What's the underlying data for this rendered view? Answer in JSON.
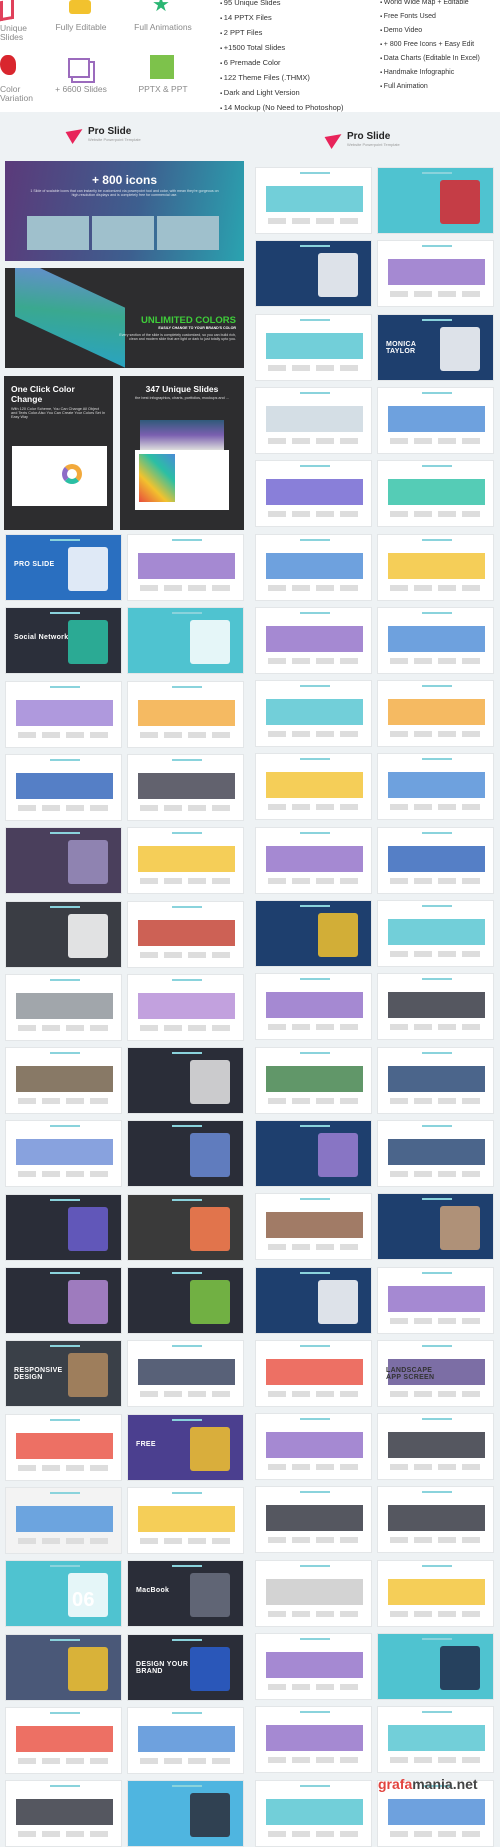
{
  "features": [
    {
      "label": "Unique Slides",
      "icon": "layers-icon",
      "color": "#e0405a"
    },
    {
      "label": "Fully Editable",
      "icon": "pencil-star-icon",
      "color": "#f2c22e"
    },
    {
      "label": "Full Animations",
      "icon": "star-icon",
      "color": "#2bb673"
    },
    {
      "label": "Color Variation",
      "icon": "palette-icon",
      "color": "#d9262e"
    },
    {
      "label": "+ 6600 Slides",
      "icon": "stacked-slides-icon",
      "color": "#9b6bbd"
    },
    {
      "label": "PPTX & PPT",
      "icon": "file-icon",
      "color": "#7dc24b"
    }
  ],
  "bullets_left": [
    "95 Unique Slides",
    "14 PPTX Files",
    "2 PPT Files",
    "+1500 Total Slides",
    "6 Premade Color",
    "122 Theme Files (.THMX)",
    "Dark and Light Version",
    "14 Mockup (No Need to Photoshop)"
  ],
  "bullets_right": [
    "World Wide Map + Editable",
    "Free Fonts Used",
    "Demo Video",
    "+ 800 Free Icons + Easy Edit",
    "Data Charts (Editable In Excel)",
    "Handmake Infographic",
    "Full Animation"
  ],
  "logo": {
    "title": "Pro Slide",
    "subtitle": "Website Powerpoint Template",
    "color": "#e8245a"
  },
  "promo": {
    "icons_title": "+ 800 icons",
    "icons_text": "1 Slide of scalable icons that can instantly be customized via powerpoint tool and color, with mean they're gorgeous on high-resolution displays and is completely free for commercial use.",
    "colors_title": "UNLIMITED COLORS",
    "colors_sub": "EASILY CHANGE TO YOUR BRAND'S COLOR",
    "colors_text": "Every section of the slide is completely customized, so you can build rich, clean and modern slide that are light or dark to just totally upto you.",
    "oneclick_title": "One Click Color Change",
    "oneclick_text": "With 120 Color Scheme, You Can Change All Object and Texts Color.Also You Can Create Your Colors Set In Easy Way",
    "unique_title": "347 Unique Slides",
    "unique_text": "the best infographics, charts, portfolios, mockups and ..."
  },
  "left_slides": [
    [
      [
        "#2a6fc0",
        "#ffffff",
        "PRO SLIDE"
      ],
      [
        "#ffffff",
        "#8e6bc7",
        ""
      ]
    ],
    [
      [
        "#2b2f3a",
        "#2bbfa4",
        "Social Network"
      ],
      [
        "#4fc3d0",
        "#ffffff",
        ""
      ]
    ],
    [
      [
        "#ffffff",
        "#9b7fd4",
        ""
      ],
      [
        "#ffffff",
        "#f2a93b",
        ""
      ]
    ],
    [
      [
        "#ffffff",
        "#2a5fb8",
        ""
      ],
      [
        "#ffffff",
        "#3b3b4a",
        ""
      ]
    ],
    [
      [
        "#4a3f5c",
        "#9b8fbf",
        ""
      ],
      [
        "#ffffff",
        "#f2c22e",
        ""
      ]
    ],
    [
      [
        "#3a3d44",
        "#ffffff",
        ""
      ],
      [
        "#ffffff",
        "#c0392b",
        ""
      ]
    ],
    [
      [
        "#ffffff",
        "#8a9096",
        ""
      ],
      [
        "#ffffff",
        "#b38ad6",
        ""
      ]
    ],
    [
      [
        "#ffffff",
        "#6a5840",
        ""
      ],
      [
        "#2a2d38",
        "#e8e8e8",
        ""
      ]
    ],
    [
      [
        "#ffffff",
        "#6a8bd6",
        ""
      ],
      [
        "#2a2d38",
        "#6a8bd6",
        ""
      ]
    ],
    [
      [
        "#2a2d38",
        "#6b5fd0",
        ""
      ],
      [
        "#3a3a3a",
        "#ff7f50",
        ""
      ]
    ],
    [
      [
        "#2a2d38",
        "#b38ad6",
        ""
      ],
      [
        "#2a2d38",
        "#7ec845",
        ""
      ]
    ],
    [
      [
        "#3a4048",
        "#b08a60",
        "RESPONSIVE DESIGN"
      ],
      [
        "#ffffff",
        "#2e3a56",
        ""
      ]
    ],
    [
      [
        "#ffffff",
        "#e84c3d",
        ""
      ],
      [
        "#4b3f8f",
        "#f2c22e",
        "FREE"
      ]
    ],
    [
      [
        "#f3f3f3",
        "#4a90d9",
        ""
      ],
      [
        "#ffffff",
        "#f2c22e",
        ""
      ]
    ],
    [
      [
        "#4fc3d0",
        "#ffffff",
        "06"
      ],
      [
        "#2a2d38",
        "#6a7080",
        "MacBook"
      ]
    ],
    [
      [
        "#4a5878",
        "#f2c22e",
        ""
      ],
      [
        "#2a2d38",
        "#2a5fd0",
        "DESIGN YOUR BRAND"
      ]
    ],
    [
      [
        "#ffffff",
        "#e84c3d",
        ""
      ],
      [
        "#ffffff",
        "#4a8ad6",
        ""
      ]
    ],
    [
      [
        "#ffffff",
        "#2a2d38",
        ""
      ],
      [
        "#4fb5e0",
        "#2a2d38",
        ""
      ]
    ]
  ],
  "right_slides": [
    [
      [
        "#ffffff",
        "#4fc3d0",
        ""
      ],
      [
        "#4fc3d0",
        "#d9262e",
        ""
      ]
    ],
    [
      [
        "#1e3f6e",
        "#ffffff",
        ""
      ],
      [
        "#ffffff",
        "#8e6bc7",
        ""
      ]
    ],
    [
      [
        "#ffffff",
        "#4fc3d0",
        ""
      ],
      [
        "#1e3f6e",
        "#ffffff",
        "MONICA TAYLOR"
      ]
    ],
    [
      [
        "#ffffff",
        "#c9d6df",
        ""
      ],
      [
        "#ffffff",
        "#4a8ad6",
        ""
      ]
    ],
    [
      [
        "#ffffff",
        "#6b5fd0",
        ""
      ],
      [
        "#ffffff",
        "#2bbfa4",
        ""
      ]
    ],
    [
      [
        "#ffffff",
        "#4a8ad6",
        ""
      ],
      [
        "#ffffff",
        "#f2c22e",
        ""
      ]
    ],
    [
      [
        "#ffffff",
        "#8e6bc7",
        ""
      ],
      [
        "#ffffff",
        "#4a8ad6",
        ""
      ]
    ],
    [
      [
        "#ffffff",
        "#4fc3d0",
        ""
      ],
      [
        "#ffffff",
        "#f2a93b",
        ""
      ]
    ],
    [
      [
        "#ffffff",
        "#f2c22e",
        ""
      ],
      [
        "#ffffff",
        "#4a8ad6",
        ""
      ]
    ],
    [
      [
        "#ffffff",
        "#8e6bc7",
        ""
      ],
      [
        "#ffffff",
        "#2a5fb8",
        ""
      ]
    ],
    [
      [
        "#1e3f6e",
        "#f2c22e",
        ""
      ],
      [
        "#ffffff",
        "#4fc3d0",
        ""
      ]
    ],
    [
      [
        "#ffffff",
        "#8e6bc7",
        ""
      ],
      [
        "#ffffff",
        "#2a2d38",
        ""
      ]
    ],
    [
      [
        "#ffffff",
        "#3a7d44",
        ""
      ],
      [
        "#ffffff",
        "#1e3f6e",
        ""
      ]
    ],
    [
      [
        "#1e3f6e",
        "#9b7fd4",
        ""
      ],
      [
        "#ffffff",
        "#1e3f6e",
        ""
      ]
    ],
    [
      [
        "#ffffff",
        "#8a5a40",
        ""
      ],
      [
        "#1e3f6e",
        "#c9a07a",
        ""
      ]
    ],
    [
      [
        "#1e3f6e",
        "#ffffff",
        ""
      ],
      [
        "#ffffff",
        "#8e6bc7",
        ""
      ]
    ],
    [
      [
        "#ffffff",
        "#e84c3d",
        ""
      ],
      [
        "#ffffff",
        "#5b4a8f",
        "LANDSCAPE APP SCREEN"
      ]
    ],
    [
      [
        "#ffffff",
        "#8e6bc7",
        ""
      ],
      [
        "#ffffff",
        "#2a2d38",
        ""
      ]
    ],
    [
      [
        "#ffffff",
        "#2a2d38",
        ""
      ],
      [
        "#ffffff",
        "#2a2d38",
        ""
      ]
    ],
    [
      [
        "#ffffff",
        "#c8c8c8",
        ""
      ],
      [
        "#ffffff",
        "#f2c22e",
        ""
      ]
    ],
    [
      [
        "#ffffff",
        "#8e6bc7",
        ""
      ],
      [
        "#4fc3d0",
        "#1e2a4a",
        ""
      ]
    ],
    [
      [
        "#ffffff",
        "#8e6bc7",
        ""
      ],
      [
        "#ffffff",
        "#4fc3d0",
        ""
      ]
    ],
    [
      [
        "#ffffff",
        "#4fc3d0",
        ""
      ],
      [
        "#ffffff",
        "#4a8ad6",
        ""
      ]
    ]
  ],
  "watermark": {
    "prefix": "grafa",
    "suffix": "mania.net"
  }
}
